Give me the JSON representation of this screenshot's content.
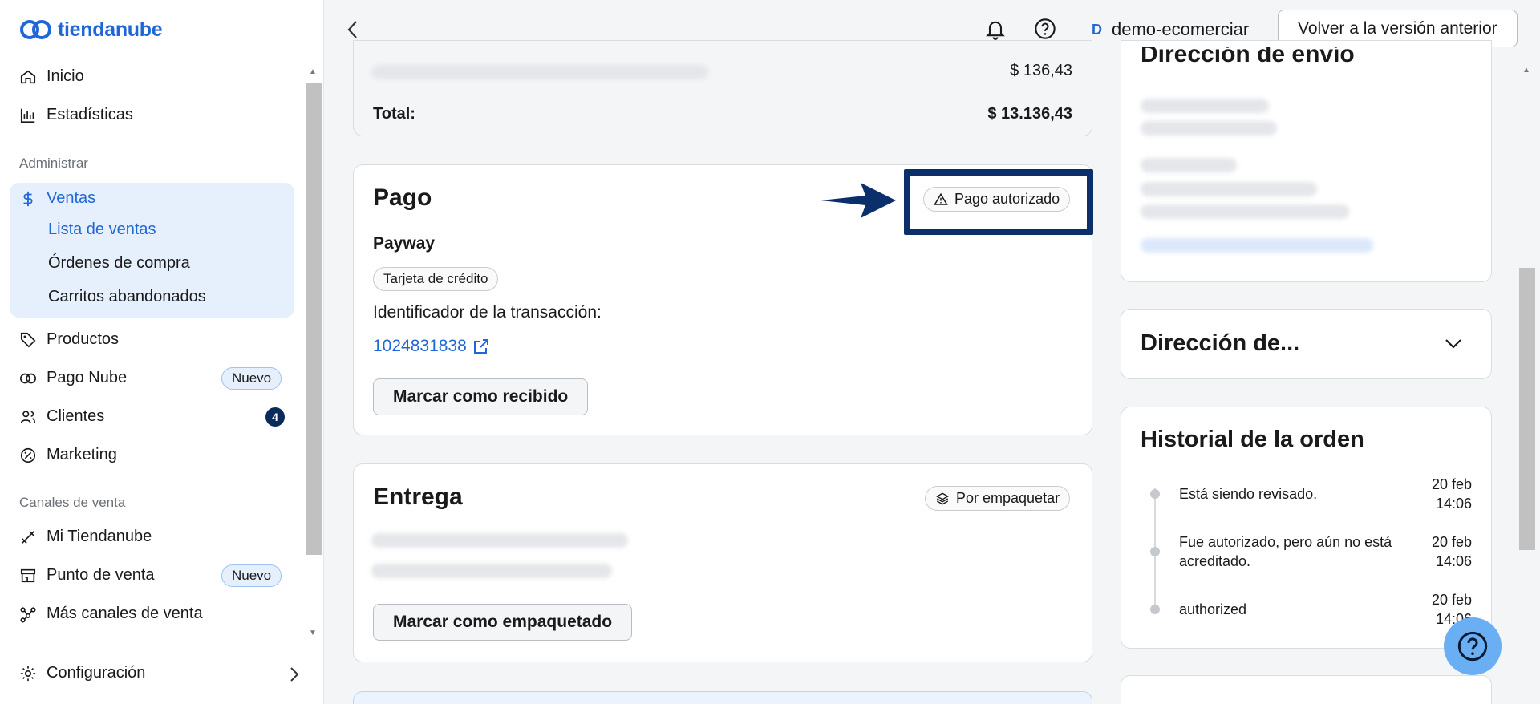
{
  "brand": {
    "name": "tiendanube",
    "color": "#1f67d6"
  },
  "sidebar": {
    "inicio": "Inicio",
    "estadisticas": "Estadísticas",
    "administrar_label": "Administrar",
    "ventas": "Ventas",
    "ventas_sub": [
      "Lista de ventas",
      "Órdenes de compra",
      "Carritos abandonados"
    ],
    "productos": "Productos",
    "pago_nube": "Pago Nube",
    "pago_nube_badge": "Nuevo",
    "clientes": "Clientes",
    "clientes_count": "4",
    "marketing": "Marketing",
    "canales_label": "Canales de venta",
    "mi_tiendanube": "Mi Tiendanube",
    "punto_venta": "Punto de venta",
    "punto_venta_badge": "Nuevo",
    "mas_canales": "Más canales de venta",
    "configuracion": "Configuración"
  },
  "topbar": {
    "user_initial": "D",
    "user_name": "demo-ecomerciar",
    "prev_version_button": "Volver a la versión anterior"
  },
  "summary": {
    "shipping_amount": "$ 136,43",
    "total_label": "Total:",
    "total_amount": "$ 13.136,43"
  },
  "payment": {
    "title": "Pago",
    "status": "Pago autorizado",
    "gateway": "Payway",
    "method": "Tarjeta de crédito",
    "transaction_label": "Identificador de la transacción:",
    "transaction_id": "1024831838",
    "mark_received_button": "Marcar como recibido"
  },
  "delivery": {
    "title": "Entrega",
    "status": "Por empaquetar",
    "mark_packaged_button": "Marcar como empaquetado"
  },
  "shipping_address": {
    "title": "Dirección de envío"
  },
  "billing_address": {
    "title": "Dirección de..."
  },
  "history": {
    "title": "Historial de la orden",
    "items": [
      {
        "text": "Está siendo revisado.",
        "date": "20 feb",
        "time": "14:06"
      },
      {
        "text": "Fue autorizado, pero aún no está acreditado.",
        "date": "20 feb",
        "time": "14:06"
      },
      {
        "text": "authorized",
        "date": "20 feb",
        "time": "14:06"
      }
    ]
  },
  "colors": {
    "accent": "#1f67d6",
    "annotation": "#0b2f6b"
  }
}
